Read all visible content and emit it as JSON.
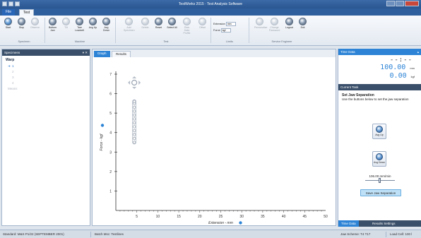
{
  "window": {
    "title": "TestWorks 2015 · Test Analysis Software"
  },
  "ribbon": {
    "tabs": [
      "File",
      "Test"
    ],
    "buttons": [
      {
        "label": "Start"
      },
      {
        "label": "Stop"
      },
      {
        "label": "Observe"
      },
      {
        "label": "Bottom Jaw"
      },
      {
        "label": "Tilt"
      },
      {
        "label": "Tare Loadcell"
      },
      {
        "label": "Avg Up"
      },
      {
        "label": "Avg Down"
      },
      {
        "label": "Add Specimen"
      },
      {
        "label": "Delete"
      },
      {
        "label": "Reset"
      },
      {
        "label": "Select All"
      },
      {
        "label": "Raw Data Profile"
      },
      {
        "label": "Offset"
      },
      {
        "label": "Personalize"
      },
      {
        "label": "Change Password"
      },
      {
        "label": "Logout"
      },
      {
        "label": "Exit"
      }
    ],
    "groups": [
      "Specimen",
      "Machine",
      "Test",
      "Limits",
      "Service Engineer"
    ],
    "limits": {
      "extension_label": "Extension",
      "extension_unit": "mm",
      "force_label": "Force",
      "force_unit": "kgf"
    }
  },
  "specimens": {
    "header": "Specimens",
    "set_name": "Warp",
    "items": [
      "1",
      "2",
      "3",
      "4"
    ],
    "footer_item": "Means",
    "selected_index": 0
  },
  "center": {
    "tabs": [
      "Graph",
      "Results"
    ],
    "active_tab": "Graph"
  },
  "chart_data": {
    "type": "scatter",
    "xlabel": "Extension - mm",
    "ylabel": "Force - kgf",
    "xlim": [
      0,
      50
    ],
    "ylim": [
      0,
      7
    ],
    "xticks": [
      5,
      10,
      15,
      20,
      25,
      30,
      35,
      40,
      45,
      50
    ],
    "yticks": [
      1,
      2,
      3,
      4,
      5,
      6,
      7
    ],
    "grid": false,
    "series": [
      {
        "x": [
          4.4,
          4.4,
          4.4,
          4.4,
          4.4,
          4.4,
          4.4,
          4.4,
          4.4,
          4.4,
          4.4,
          4.4
        ],
        "y": [
          3.5,
          3.7,
          3.9,
          4.1,
          4.3,
          4.5,
          4.7,
          4.9,
          5.1,
          5.3,
          5.5,
          5.6
        ]
      }
    ],
    "legend": "none",
    "colors": {
      "points": "#9aa4b0",
      "axis": "#333333"
    }
  },
  "right": {
    "time_data_header": "Time Data",
    "time": "--:--",
    "extension_value": "100.00",
    "extension_unit": "mm",
    "force_value": "0.00",
    "force_unit": "kgf",
    "task_header": "Current Task",
    "task_title": "Set Jaw Separation",
    "task_text": "Use the buttons below to set the jaw separation",
    "jog_up": "Avg Up",
    "jog_down": "Avg Down",
    "rate": "106.00 mm/min",
    "save_button": "Save Jaw Separation",
    "bottom_tabs": [
      "Time Data",
      "Results Settings"
    ]
  },
  "status": {
    "standard": "Standard: M&S P1/22 (SEPTEMBER 2001)",
    "batch": "Batch Msc: Testlines",
    "jaw_scheme": "Jaw Scheme: T4 T17",
    "load_cell": "Load Cell: 100 l"
  },
  "colors": {
    "accent": "#2d84d6",
    "header_dark": "#3a4f69",
    "title": "#2f5f9c"
  }
}
